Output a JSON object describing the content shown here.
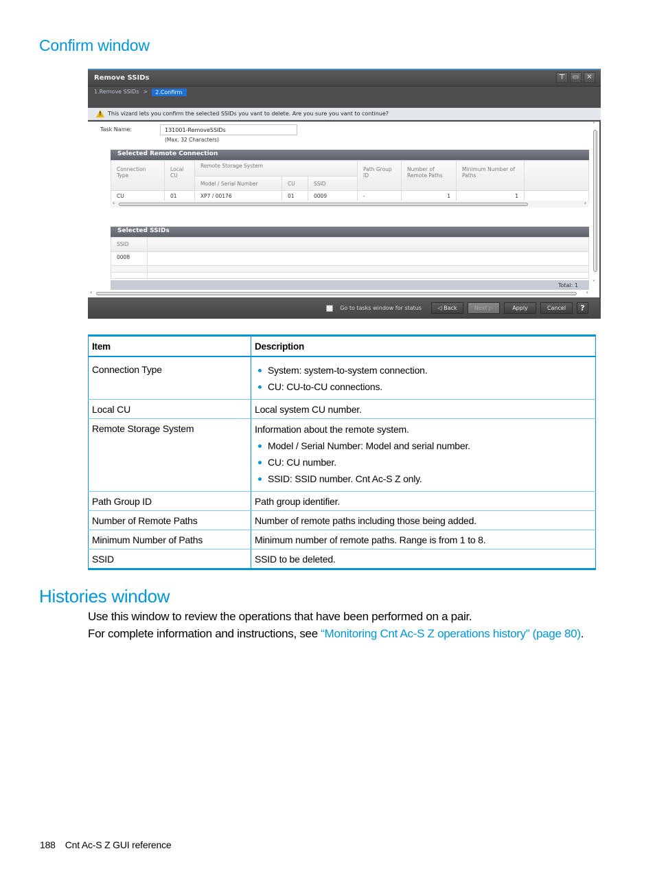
{
  "confirm_heading": "Confirm window",
  "dialog": {
    "title": "Remove SSIDs",
    "window_controls": [
      {
        "icon": "pin-icon",
        "glyph": "⊤"
      },
      {
        "icon": "maximize-icon",
        "glyph": "▭"
      },
      {
        "icon": "close-icon",
        "glyph": "✕"
      }
    ],
    "steps": {
      "step1": "1.Remove SSIDs",
      "separator": ">",
      "step2": "2.Confirm"
    },
    "warning": "This vizard lets you confirm the selected SSIDs you vant to delete. Are you sure you vant to continue?",
    "task_name_label": "Task Name:",
    "task_name_value": "131001-RemoveSSIDs",
    "task_name_hint": "(Max. 32 Characters)",
    "remote_connection": {
      "title": "Selected Remote Connection",
      "headers": {
        "connection_type": "Connection Type",
        "local_cu": "Local CU",
        "remote_storage_system": "Remote Storage System",
        "model_serial": "Model / Serial Number",
        "cu": "CU",
        "ssid": "SSID",
        "path_group_id": "Path Group ID",
        "num_remote_paths": "Number of Remote Paths",
        "min_num_paths": "Minimum Number of Paths"
      },
      "rows": [
        {
          "connection_type": "CU",
          "local_cu": "01",
          "model_serial": "XP7 / 00176",
          "cu": "01",
          "ssid": "0009",
          "path_group_id": "-",
          "num_remote_paths": "1",
          "min_num_paths": "1"
        }
      ]
    },
    "selected_ssids": {
      "title": "Selected SSIDs",
      "header": "SSID",
      "rows": [
        "0008"
      ],
      "total": "Total: 1"
    },
    "footer": {
      "checkbox_label": "Go to tasks window for status",
      "checkbox_checked": false,
      "back": "◁ Back",
      "next": "Next ▷",
      "apply": "Apply",
      "cancel": "Cancel",
      "help": "?"
    },
    "scroll": {
      "left": "‹",
      "right": "›",
      "up": "˄",
      "down": "˅"
    }
  },
  "description_table": {
    "headers": {
      "item": "Item",
      "description": "Description"
    },
    "rows": [
      {
        "item": "Connection Type",
        "bullets": [
          "System: system-to-system connection.",
          "CU: CU-to-CU connections."
        ]
      },
      {
        "item": "Local CU",
        "description": "Local system CU number."
      },
      {
        "item": "Remote Storage System",
        "description": "Information about the remote system.",
        "bullets": [
          "Model / Serial Number: Model and serial number.",
          "CU: CU number.",
          "SSID: SSID number. Cnt Ac-S Z only."
        ]
      },
      {
        "item": "Path Group ID",
        "description": "Path group identifier."
      },
      {
        "item": "Number of Remote Paths",
        "description": "Number of remote paths including those being added."
      },
      {
        "item": "Minimum Number of Paths",
        "description": "Minimum number of remote paths. Range is from 1 to 8."
      },
      {
        "item": "SSID",
        "description": "SSID to be deleted."
      }
    ]
  },
  "histories": {
    "heading": "Histories window",
    "para1": "Use this window to review the operations that have been performed on a pair.",
    "para2_prefix": "For complete information and instructions, see ",
    "para2_link": "“Monitoring Cnt Ac-S Z operations history” (page 80)",
    "para2_suffix": "."
  },
  "page_footer": {
    "page_number": "188",
    "section": "Cnt Ac-S Z GUI reference"
  }
}
